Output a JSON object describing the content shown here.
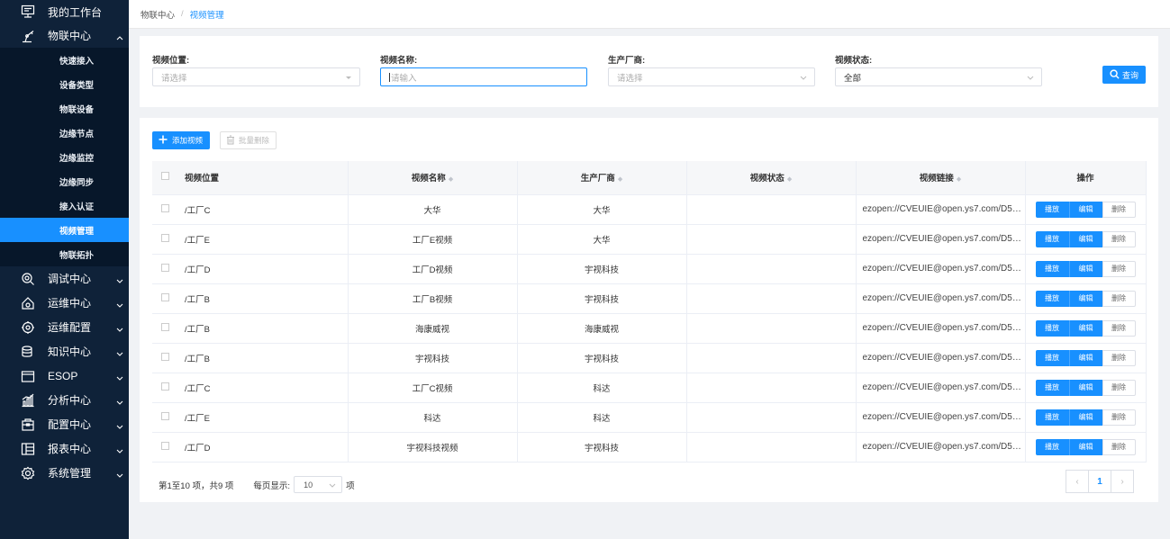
{
  "sidebar": {
    "top_item": {
      "label": "我的工作台",
      "icon": "monitor-icon"
    },
    "open_section": {
      "label": "物联中心",
      "icon": "robot-arm-icon"
    },
    "sub_items": [
      {
        "label": "快速接入",
        "active": false
      },
      {
        "label": "设备类型",
        "active": false
      },
      {
        "label": "物联设备",
        "active": false
      },
      {
        "label": "边缘节点",
        "active": false
      },
      {
        "label": "边缘监控",
        "active": false
      },
      {
        "label": "边缘同步",
        "active": false
      },
      {
        "label": "接入认证",
        "active": false
      },
      {
        "label": "视频管理",
        "active": true
      },
      {
        "label": "物联拓扑",
        "active": false
      }
    ],
    "sections": [
      {
        "label": "调试中心",
        "icon": "debug-icon"
      },
      {
        "label": "运维中心",
        "icon": "ops-house-icon"
      },
      {
        "label": "运维配置",
        "icon": "ops-gear-icon"
      },
      {
        "label": "知识中心",
        "icon": "knowledge-icon"
      },
      {
        "label": "ESOP",
        "icon": "esop-icon"
      },
      {
        "label": "分析中心",
        "icon": "analysis-chart-icon"
      },
      {
        "label": "配置中心",
        "icon": "config-box-icon"
      },
      {
        "label": "报表中心",
        "icon": "report-icon"
      },
      {
        "label": "系统管理",
        "icon": "settings-gear-icon"
      }
    ]
  },
  "breadcrumb": {
    "parent": "物联中心",
    "separator": "/",
    "current": "视频管理"
  },
  "filters": {
    "location": {
      "label": "视频位置:",
      "placeholder": "请选择"
    },
    "name": {
      "label": "视频名称:",
      "placeholder": "请输入"
    },
    "vendor": {
      "label": "生产厂商:",
      "placeholder": "请选择"
    },
    "status": {
      "label": "视频状态:",
      "value": "全部"
    },
    "search_label": "查询"
  },
  "toolbar": {
    "add_label": "添加视频",
    "batch_delete_label": "批量删除"
  },
  "table": {
    "headers": {
      "location": "视频位置",
      "name": "视频名称",
      "vendor": "生产厂商",
      "status": "视频状态",
      "link": "视频链接",
      "ops": "操作"
    },
    "rows": [
      {
        "location": "/工厂C",
        "name": "大华",
        "vendor": "大华",
        "status": "",
        "link": "ezopen://CVEUIE@open.ys7.com/D50..."
      },
      {
        "location": "/工厂E",
        "name": "工厂E视频",
        "vendor": "大华",
        "status": "",
        "link": "ezopen://CVEUIE@open.ys7.com/D50..."
      },
      {
        "location": "/工厂D",
        "name": "工厂D视频",
        "vendor": "宇视科技",
        "status": "",
        "link": "ezopen://CVEUIE@open.ys7.com/D50..."
      },
      {
        "location": "/工厂B",
        "name": "工厂B视频",
        "vendor": "宇视科技",
        "status": "",
        "link": "ezopen://CVEUIE@open.ys7.com/D50..."
      },
      {
        "location": "/工厂B",
        "name": "海康威视",
        "vendor": "海康威视",
        "status": "",
        "link": "ezopen://CVEUIE@open.ys7.com/D50..."
      },
      {
        "location": "/工厂B",
        "name": "宇视科技",
        "vendor": "宇视科技",
        "status": "",
        "link": "ezopen://CVEUIE@open.ys7.com/D50..."
      },
      {
        "location": "/工厂C",
        "name": "工厂C视频",
        "vendor": "科达",
        "status": "",
        "link": "ezopen://CVEUIE@open.ys7.com/D50..."
      },
      {
        "location": "/工厂E",
        "name": "科达",
        "vendor": "科达",
        "status": "",
        "link": "ezopen://CVEUIE@open.ys7.com/D50..."
      },
      {
        "location": "/工厂D",
        "name": "宇视科技视频",
        "vendor": "宇视科技",
        "status": "",
        "link": "ezopen://CVEUIE@open.ys7.com/D50..."
      }
    ],
    "ops": {
      "play": "播放",
      "edit": "编辑",
      "delete": "删除"
    }
  },
  "pagination": {
    "summary": "第1至10 项，共9 项",
    "per_page_label": "每页显示:",
    "per_page_value": "10",
    "unit": "项",
    "current_page": "1",
    "prev": "‹",
    "next": "›"
  },
  "colors": {
    "primary": "#1890ff",
    "sidebar_bg": "#0f2239",
    "submenu_bg": "#07172a"
  }
}
